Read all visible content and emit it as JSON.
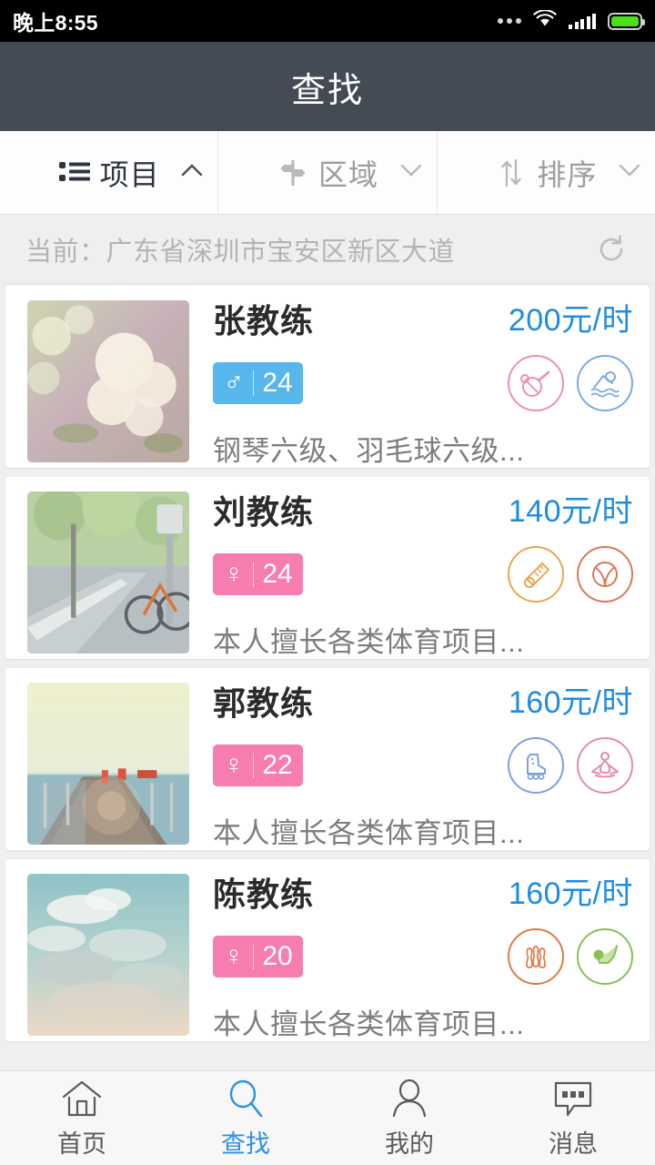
{
  "status_bar": {
    "time": "晚上8:55",
    "dots_icon": "more-dots-icon",
    "wifi_icon": "wifi-icon",
    "signal_icon": "cellular-signal-icon",
    "battery_icon": "battery-full-icon",
    "battery_color": "#49e218"
  },
  "header": {
    "title": "查找",
    "background": "#454b55"
  },
  "filters": [
    {
      "label": "项目",
      "icon": "list-icon",
      "caret": "chevron-up-icon",
      "expanded": true,
      "active": true
    },
    {
      "label": "区域",
      "icon": "signpost-icon",
      "caret": "chevron-down-icon",
      "expanded": false,
      "active": false
    },
    {
      "label": "排序",
      "icon": "sort-arrows-icon",
      "caret": "chevron-down-icon",
      "expanded": false,
      "active": false
    }
  ],
  "location": {
    "text": "当前：广东省深圳市宝安区新区大道",
    "refresh_icon": "refresh-icon"
  },
  "coaches": [
    {
      "name": "张教练",
      "price": "200元/时",
      "gender": "male",
      "gender_symbol": "♂",
      "age": "24",
      "desc": "钢琴六级、羽毛球六级...",
      "badge_color": "#57b6ec",
      "thumb": "white-roses-photo",
      "sports": [
        {
          "name": "table-tennis-icon",
          "color": "#ef8fb4"
        },
        {
          "name": "swimming-icon",
          "color": "#7fa8e8"
        }
      ]
    },
    {
      "name": "刘教练",
      "price": "140元/时",
      "gender": "female",
      "gender_symbol": "♀",
      "age": "24",
      "desc": "本人擅长各类体育项目...",
      "badge_color": "#f77cb0",
      "thumb": "bicycle-street-photo",
      "sports": [
        {
          "name": "badminton-shuttlecock-icon",
          "color": "#e8a855"
        },
        {
          "name": "tennis-ball-icon",
          "color": "#d9785c"
        }
      ]
    },
    {
      "name": "郭教练",
      "price": "160元/时",
      "gender": "female",
      "gender_symbol": "♀",
      "age": "22",
      "desc": "本人擅长各类体育项目...",
      "badge_color": "#f77cb0",
      "thumb": "pier-sunset-photo",
      "sports": [
        {
          "name": "roller-skate-icon",
          "color": "#7fa0e0"
        },
        {
          "name": "yoga-icon",
          "color": "#e58ba8"
        }
      ]
    },
    {
      "name": "陈教练",
      "price": "160元/时",
      "gender": "female",
      "gender_symbol": "♀",
      "age": "20",
      "desc": "本人擅长各类体育项目...",
      "badge_color": "#f77cb0",
      "thumb": "clouds-sky-photo",
      "sports": [
        {
          "name": "bowling-icon",
          "color": "#e07a44"
        },
        {
          "name": "golf-icon",
          "color": "#89c055"
        }
      ]
    }
  ],
  "tabbar": [
    {
      "label": "首页",
      "icon": "home-icon",
      "active": false
    },
    {
      "label": "查找",
      "icon": "search-icon",
      "active": true
    },
    {
      "label": "我的",
      "icon": "person-icon",
      "active": false
    },
    {
      "label": "消息",
      "icon": "message-icon",
      "active": false
    }
  ],
  "accent_color": "#2a90ef"
}
